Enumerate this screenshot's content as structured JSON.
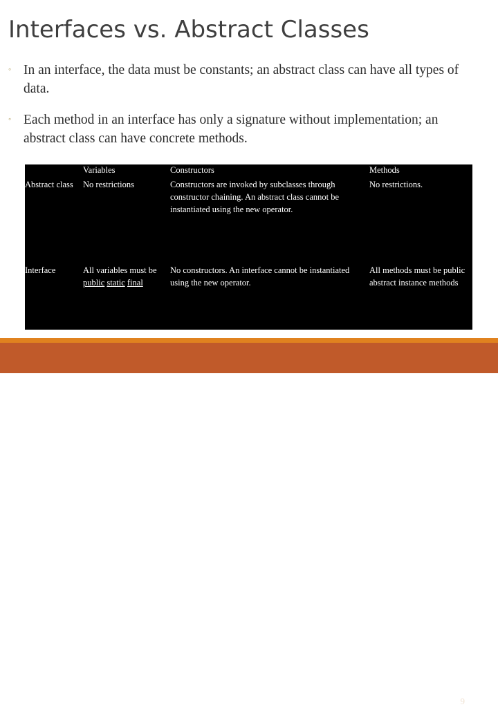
{
  "slide": {
    "title": "Interfaces vs. Abstract Classes",
    "bullet_marker": "◦",
    "bullets": [
      "In an interface, the data must be constants; an abstract class can have all types of data.",
      "Each method in an interface has only a signature without implementation; an abstract class can have concrete methods."
    ],
    "page_number": "9"
  },
  "table": {
    "headers": [
      "",
      "Variables",
      "Constructors",
      "Methods"
    ],
    "rows": [
      {
        "label": "Abstract class",
        "variables": "No restrictions",
        "constructors": "Constructors are invoked by subclasses through constructor chaining. An abstract class cannot be instantiated using the new operator.",
        "methods": "No restrictions."
      },
      {
        "label": "Interface",
        "variables_prefix": "All variables must be ",
        "variables_kw1": "public",
        "variables_kw2": "static",
        "variables_kw3": "final",
        "constructors": "No constructors. An interface cannot be instantiated using the new operator.",
        "methods": "All methods must be public abstract instance methods"
      }
    ]
  },
  "colors": {
    "title_text": "#3f3f3f",
    "body_text": "#2b2b2b",
    "bullet_marker": "#b09b5b",
    "table_background": "#000000",
    "table_text": "#ffffff",
    "footer_stripe": "#e0821f",
    "footer_bar": "#c05a2a",
    "page_number_text": "#f0e2d2"
  }
}
